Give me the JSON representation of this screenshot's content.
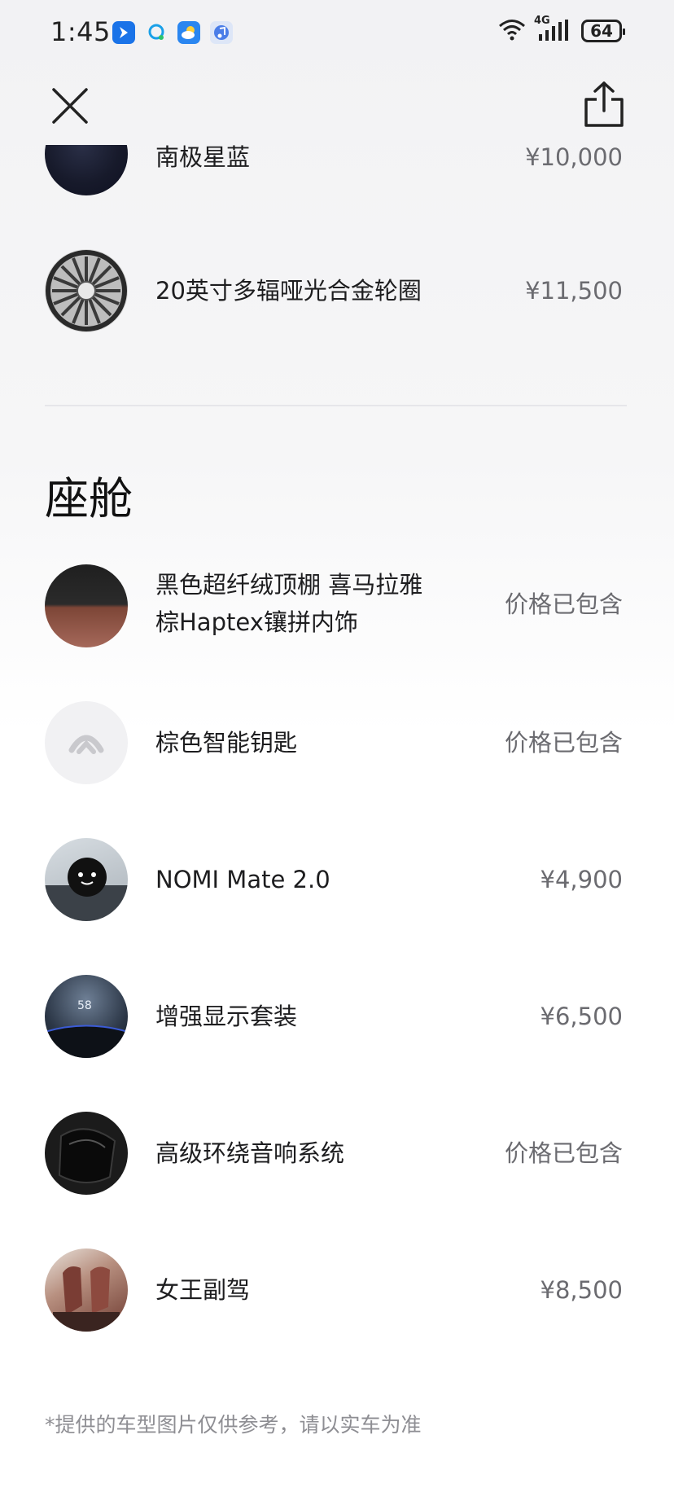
{
  "status_bar": {
    "time": "1:45",
    "network": "4G",
    "battery": "64",
    "notification_icons": [
      "maps-icon",
      "chat-icon",
      "weather-icon",
      "music-icon"
    ]
  },
  "nav": {
    "close_icon": "close-icon",
    "share_icon": "share-icon"
  },
  "exterior_items": [
    {
      "name": "南极星蓝",
      "price": "¥10,000",
      "thumb": "paint-swatch-dark-blue"
    },
    {
      "name": "20英寸多辐哑光合金轮圈",
      "price": "¥11,500",
      "thumb": "wheel-rim"
    }
  ],
  "cabin": {
    "title": "座舱",
    "items": [
      {
        "name_line1": "黑色超纤绒顶棚 喜马拉雅",
        "name_line2": "棕Haptex镶拼内饰",
        "price": "价格已包含",
        "thumb": "interior-material-swatch"
      },
      {
        "name": "棕色智能钥匙",
        "price": "价格已包含",
        "thumb": "smart-key-logo"
      },
      {
        "name": "NOMI Mate 2.0",
        "price": "¥4,900",
        "thumb": "nomi-robot"
      },
      {
        "name": "增强显示套装",
        "price": "¥6,500",
        "thumb": "hud-display",
        "thumb_text": "58"
      },
      {
        "name": "高级环绕音响系统",
        "price": "价格已包含",
        "thumb": "speaker"
      },
      {
        "name": "女王副驾",
        "price": "¥8,500",
        "thumb": "queen-seat"
      }
    ]
  },
  "footnote": "*提供的车型图片仅供参考，请以实车为准",
  "colors": {
    "primary_text": "#1d1d1f",
    "price_text": "#6b6b70",
    "footnote": "#8e8e93",
    "paint_blue": "#171a2b"
  }
}
